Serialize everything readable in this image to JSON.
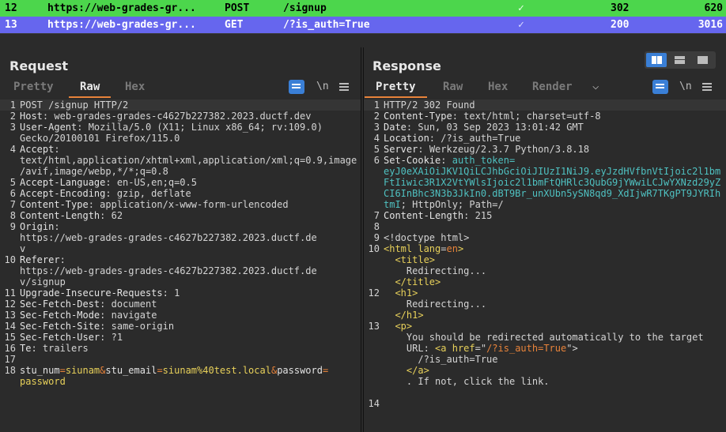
{
  "history": {
    "rows": [
      {
        "num": "12",
        "host": "https://web-grades-gr...",
        "method": "POST",
        "url": "/signup",
        "check": "✓",
        "status": "302",
        "length": "620"
      },
      {
        "num": "13",
        "host": "https://web-grades-gr...",
        "method": "GET",
        "url": "/?is_auth=True",
        "check": "✓",
        "status": "200",
        "length": "3016"
      }
    ],
    "colors": {
      "post_row": "#4cd64c",
      "selected_row": "#6666ee"
    }
  },
  "request": {
    "title": "Request",
    "tabs": [
      "Pretty",
      "Raw",
      "Hex"
    ],
    "active_tab": "Raw",
    "newline_toggle": "\\n",
    "lines": [
      {
        "n": "1",
        "t": "POST /signup HTTP/2"
      },
      {
        "n": "2",
        "k": "Host",
        "v": " web-grades-grades-c4627b227382.2023.ductf.dev"
      },
      {
        "n": "3",
        "k": "User-Agent",
        "v": " Mozilla/5.0 (X11; Linux x86_64; rv:109.0)"
      },
      {
        "n": "",
        "t": "Gecko/20100101 Firefox/115.0"
      },
      {
        "n": "4",
        "k": "Accept",
        "v": ""
      },
      {
        "n": "",
        "t": "text/html,application/xhtml+xml,application/xml;q=0.9,image"
      },
      {
        "n": "",
        "t": "/avif,image/webp,*/*;q=0.8"
      },
      {
        "n": "5",
        "k": "Accept-Language",
        "v": " en-US,en;q=0.5"
      },
      {
        "n": "6",
        "k": "Accept-Encoding",
        "v": " gzip, deflate"
      },
      {
        "n": "7",
        "k": "Content-Type",
        "v": " application/x-www-form-urlencoded"
      },
      {
        "n": "8",
        "k": "Content-Length",
        "v": " 62"
      },
      {
        "n": "9",
        "k": "Origin",
        "v": ""
      },
      {
        "n": "",
        "t": "https://web-grades-grades-c4627b227382.2023.ductf.de"
      },
      {
        "n": "",
        "t": "v"
      },
      {
        "n": "10",
        "k": "Referer",
        "v": ""
      },
      {
        "n": "",
        "t": "https://web-grades-grades-c4627b227382.2023.ductf.de"
      },
      {
        "n": "",
        "t": "v/signup"
      },
      {
        "n": "11",
        "k": "Upgrade-Insecure-Requests",
        "v": " 1"
      },
      {
        "n": "12",
        "k": "Sec-Fetch-Dest",
        "v": " document"
      },
      {
        "n": "13",
        "k": "Sec-Fetch-Mode",
        "v": " navigate"
      },
      {
        "n": "14",
        "k": "Sec-Fetch-Site",
        "v": " same-origin"
      },
      {
        "n": "15",
        "k": "Sec-Fetch-User",
        "v": " ?1"
      },
      {
        "n": "16",
        "k": "Te",
        "v": " trailers"
      },
      {
        "n": "17",
        "t": ""
      },
      {
        "n": "18",
        "body": [
          [
            "stu_num",
            "="
          ],
          [
            "siunam",
            "&"
          ],
          [
            "stu_email",
            "="
          ],
          [
            "siunam%40test.local",
            "&"
          ],
          [
            "password",
            "="
          ]
        ]
      },
      {
        "n": "",
        "bodycont": "password"
      }
    ]
  },
  "response": {
    "title": "Response",
    "tabs": [
      "Pretty",
      "Raw",
      "Hex",
      "Render"
    ],
    "active_tab": "Pretty",
    "newline_toggle": "\\n",
    "lines": [
      {
        "n": "1",
        "t": "HTTP/2 302 Found"
      },
      {
        "n": "2",
        "k": "Content-Type",
        "v": " text/html; charset=utf-8"
      },
      {
        "n": "3",
        "k": "Date",
        "v": " Sun, 03 Sep 2023 13:01:42 GMT"
      },
      {
        "n": "4",
        "k": "Location",
        "v": " /?is_auth=True"
      },
      {
        "n": "5",
        "k": "Server",
        "v": " Werkzeug/2.3.7 Python/3.8.18"
      },
      {
        "n": "6",
        "k": "Set-Cookie",
        "v": " ",
        "tok": "auth_token="
      },
      {
        "n": "",
        "tokline": "eyJ0eXAiOiJKV1QiLCJhbGciOiJIUzI1NiJ9.eyJzdHVfbnVtIjoic2l1bm"
      },
      {
        "n": "",
        "tokline": "FtIiwic3R1X2VtYWlsIjoic2l1bmFtQHRlc3QubG9jYWwiLCJwYXNzd29yZ"
      },
      {
        "n": "",
        "tokline": "CI6InBhc3N3b3JkIn0.dBT9Br_unXUbn5ySN8qd9_XdIjwR7TKgPT9JYRIh"
      },
      {
        "n": "",
        "tokline": "tmI",
        "rest": "; HttpOnly; Path=/"
      },
      {
        "n": "7",
        "k": "Content-Length",
        "v": " 215"
      },
      {
        "n": "8",
        "t": ""
      },
      {
        "n": "9",
        "t": "<!doctype html>"
      },
      {
        "n": "10",
        "html": [
          [
            "<html ",
            "tag"
          ],
          [
            "lang",
            "attr"
          ],
          [
            "=",
            "plain"
          ],
          [
            "en",
            "aval"
          ],
          [
            ">",
            "tag"
          ]
        ]
      },
      {
        "n": "",
        "html": [
          [
            "  <title>",
            "tag"
          ]
        ]
      },
      {
        "n": "",
        "t": "    Redirecting..."
      },
      {
        "n": "",
        "html": [
          [
            "  </title>",
            "tag"
          ]
        ]
      },
      {
        "n": "12",
        "html": [
          [
            "  <h1>",
            "tag"
          ]
        ]
      },
      {
        "n": "",
        "t": "    Redirecting..."
      },
      {
        "n": "",
        "html": [
          [
            "  </h1>",
            "tag"
          ]
        ]
      },
      {
        "n": "13",
        "html": [
          [
            "  <p>",
            "tag"
          ]
        ]
      },
      {
        "n": "",
        "t": "    You should be redirected automatically to the target"
      },
      {
        "n": "",
        "html": [
          [
            "    URL: ",
            "plain"
          ],
          [
            "<a ",
            "tag"
          ],
          [
            "href",
            "attr"
          ],
          [
            "=\"",
            "plain"
          ],
          [
            "/?is_auth=True",
            "aval"
          ],
          [
            "\">",
            "plain"
          ]
        ]
      },
      {
        "n": "",
        "t": "      /?is_auth=True"
      },
      {
        "n": "",
        "html": [
          [
            "    </a>",
            "tag"
          ]
        ]
      },
      {
        "n": "",
        "t": "    . If not, click the link."
      },
      {
        "n": "",
        "t": ""
      },
      {
        "n": "14",
        "t": ""
      }
    ]
  },
  "layout_buttons": [
    "split-horizontal",
    "split-vertical",
    "single"
  ],
  "accent_color": "#e8833a"
}
